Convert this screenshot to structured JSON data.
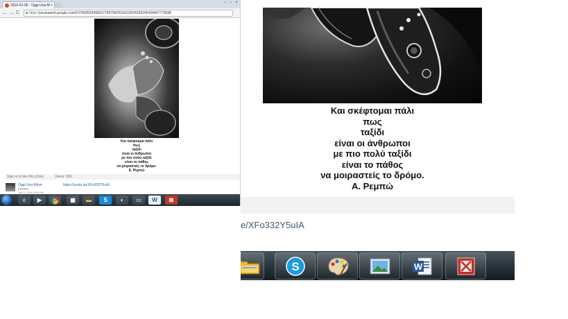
{
  "small": {
    "tab_title": "2016-01-05 - Oggi Una M",
    "tab_close": "×",
    "window_controls": "– ▫ ×",
    "nav_back": "←",
    "nav_forward": "→",
    "nav_reload": "C",
    "url_scheme": "https://",
    "url_rest": "picasaweb.google.com/107508929496937795758/20160105#6236345434467779538",
    "caption_lines": [
      "Και σκέφτομαι πάλι",
      "πως",
      "ταξίδι",
      "είναι οι άνθρωποι",
      "με πιο πολύ ταξίδι",
      "είναι το πάθος",
      "να μοιραστείς το δρόμο.",
      "Α. Ρεμπώ"
    ],
    "signin_text": "Sign in to like this photo",
    "views_text": "Views: 999",
    "user_name": "Oggi Una Minor",
    "user_posts": "photos",
    "post_date": "Jan 5, 2016 6:46 PM",
    "video_link": "https://youtu.be/XFo332Y5uIA",
    "taskbar_word": "W"
  },
  "large": {
    "caption_lines": [
      "Και σκέφτομαι πάλι",
      "πως",
      "ταξίδι",
      "είναι οι άνθρωποι",
      "με πιο πολύ ταξίδι",
      "είναι το πάθος",
      "να μοιραστείς το δρόμο.",
      "Α. Ρεμπώ"
    ],
    "video_link_partial": "e/XFo332Y5uIA",
    "taskbar_word": "W"
  },
  "colors": {
    "link": "#2a5db0",
    "taskbar_dark": "#1d262e",
    "signin_bar": "#f2f2f2"
  }
}
